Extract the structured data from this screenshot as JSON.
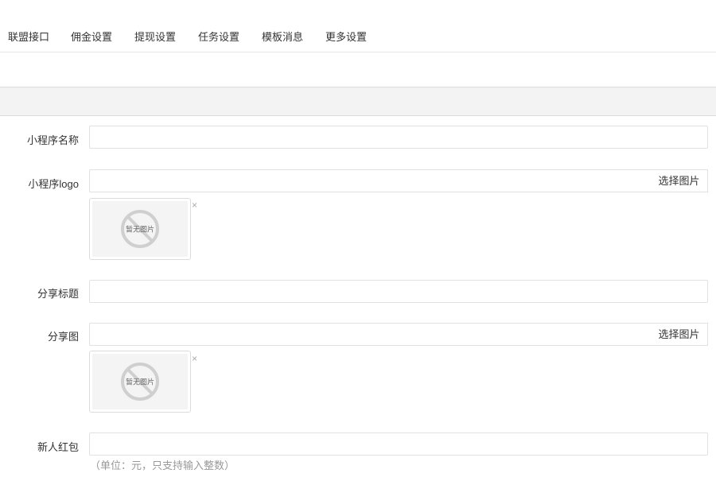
{
  "tabs": [
    "联盟接口",
    "佣金设置",
    "提现设置",
    "任务设置",
    "模板消息",
    "更多设置"
  ],
  "form": {
    "app_name_label": "小程序名称",
    "app_logo_label": "小程序logo",
    "share_title_label": "分享标题",
    "share_image_label": "分享图",
    "new_user_redpacket_label": "新人红包",
    "select_image_label": "选择图片",
    "no_image_text": "暂无图片",
    "remove_glyph": "×",
    "redpacket_hint": "（单位：元，只支持输入整数）"
  },
  "values": {
    "app_name": "",
    "share_title": "",
    "new_user_redpacket": ""
  }
}
